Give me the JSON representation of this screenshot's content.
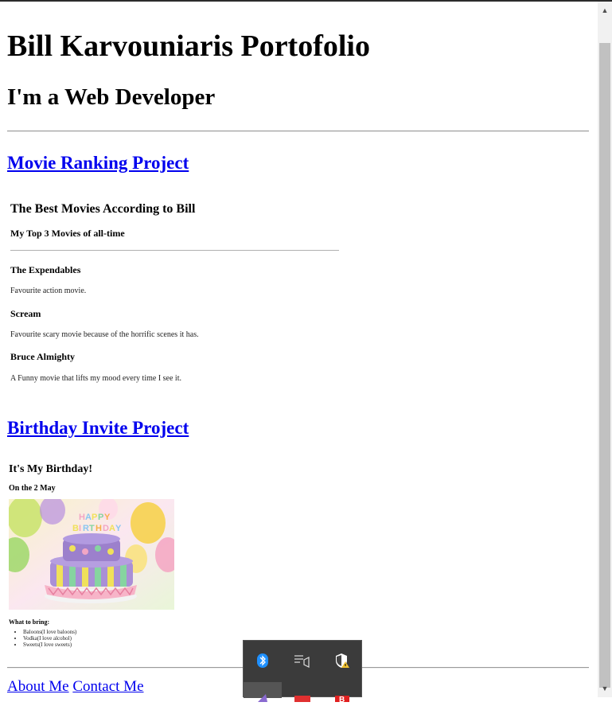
{
  "header": {
    "title": "Bill Karvouniaris Portofolio",
    "subtitle": "I'm a Web Developer"
  },
  "projects": {
    "movie_link": "Movie Ranking Project",
    "birthday_link": "Birthday Invite Project"
  },
  "movie_page": {
    "title": "The Best Movies According to Bill",
    "subtitle": "My Top 3 Movies of all-time",
    "movies": [
      {
        "name": "The Expendables",
        "desc": "Favourite action movie."
      },
      {
        "name": "Scream",
        "desc": "Favourite scary movie because of the horrific scenes it has."
      },
      {
        "name": "Bruce Almighty",
        "desc": "A Funny movie that lifts my mood every time I see it."
      }
    ]
  },
  "birthday_page": {
    "title": "It's My Birthday!",
    "date": "On the 2 May",
    "cake_text": "HAPPY BIRTHDAY",
    "bring_label": "What to bring:",
    "items": [
      "Baloons(I love baloons)",
      "Vodka(I love alcohol)",
      "Sweets(I love sweets)"
    ]
  },
  "footer": {
    "about": "About Me",
    "contact": "Contact Me"
  },
  "tray": {
    "icons": [
      "bluetooth-icon",
      "media-cast-icon",
      "security-warning-icon",
      "app-icon",
      "app-icon",
      "app-icon"
    ]
  },
  "colors": {
    "link": "#0000ee",
    "tray_bg": "#3b3b3b",
    "bluetooth": "#1e90ff"
  }
}
